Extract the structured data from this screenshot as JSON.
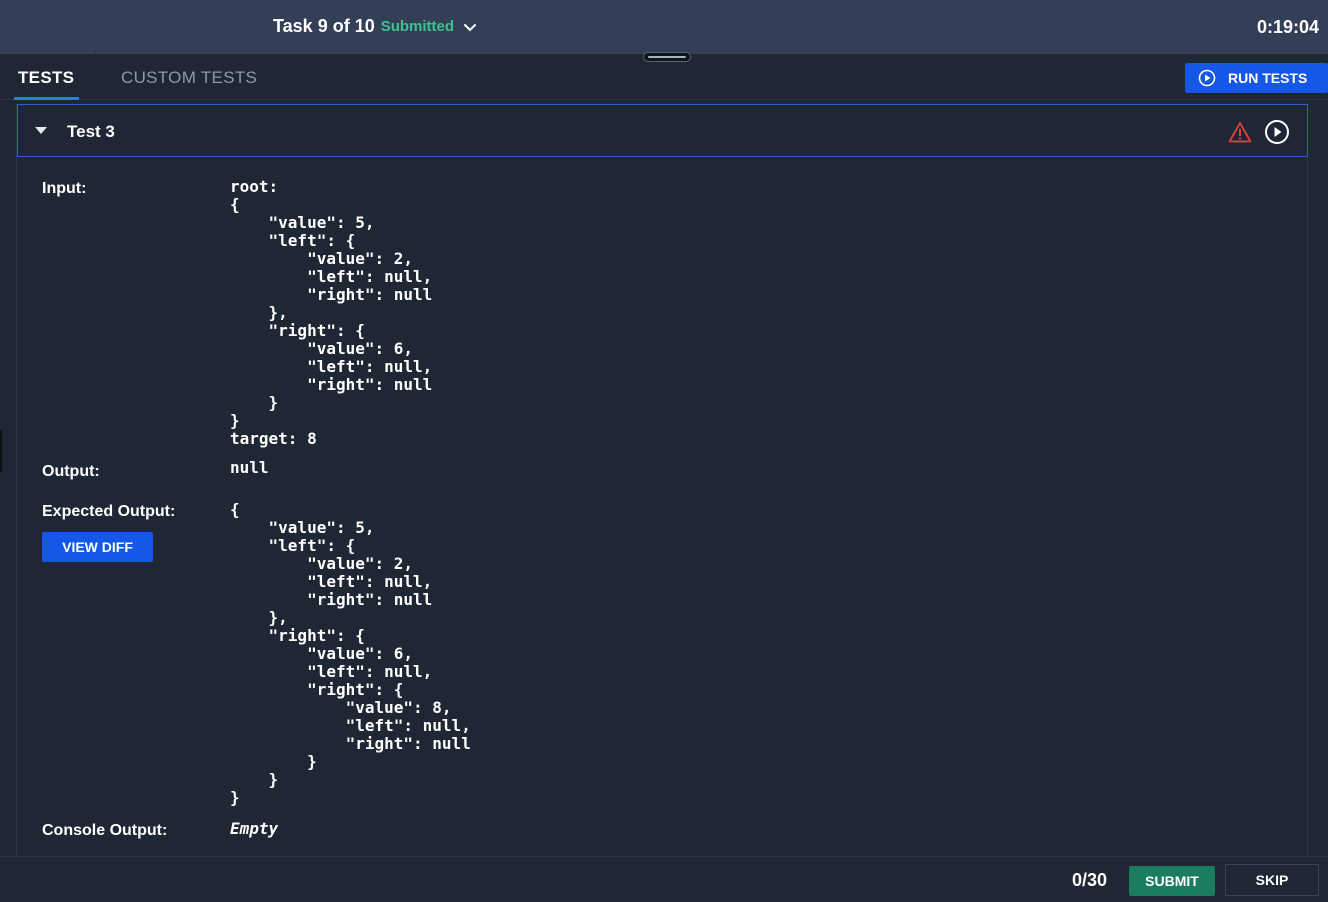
{
  "header": {
    "task_label": "Task 9 of 10",
    "status": "Submitted",
    "timer": "0:19:04"
  },
  "tabs": [
    {
      "label": "TESTS",
      "active": true
    },
    {
      "label": "CUSTOM TESTS",
      "active": false
    }
  ],
  "run_tests_label": "RUN TESTS",
  "test": {
    "title": "Test 3",
    "input_label": "Input:",
    "input_value": "root:\n{\n    \"value\": 5,\n    \"left\": {\n        \"value\": 2,\n        \"left\": null,\n        \"right\": null\n    },\n    \"right\": {\n        \"value\": 6,\n        \"left\": null,\n        \"right\": null\n    }\n}\ntarget: 8",
    "output_label": "Output:",
    "output_value": "null",
    "expected_label": "Expected Output:",
    "expected_value": "{\n    \"value\": 5,\n    \"left\": {\n        \"value\": 2,\n        \"left\": null,\n        \"right\": null\n    },\n    \"right\": {\n        \"value\": 6,\n        \"left\": null,\n        \"right\": {\n            \"value\": 8,\n            \"left\": null,\n            \"right\": null\n        }\n    }\n}",
    "view_diff_label": "VIEW DIFF",
    "console_label": "Console Output:",
    "console_value": "Empty"
  },
  "footer": {
    "score": "0/30",
    "submit_label": "SUBMIT",
    "skip_label": "SKIP"
  },
  "colors": {
    "accent_blue": "#1557e6",
    "submitted_green": "#3ec28f",
    "submit_green": "#1a7d5f",
    "warning_red": "#e0423a"
  }
}
